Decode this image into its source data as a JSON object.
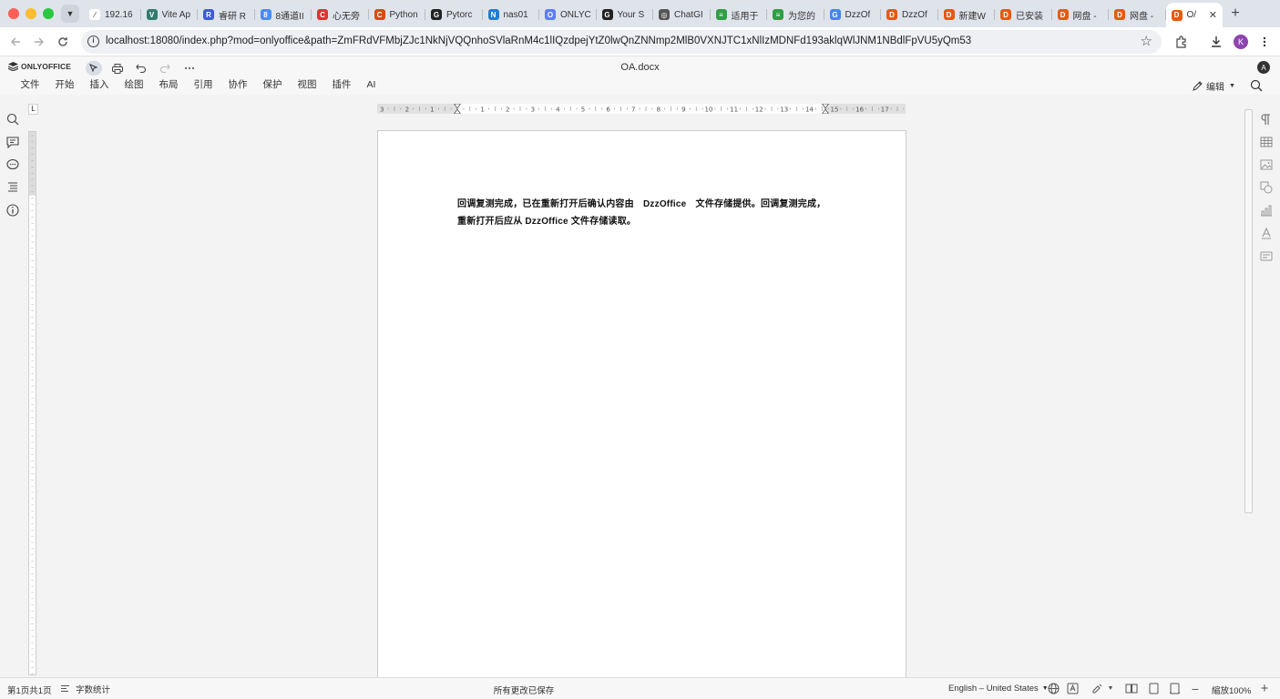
{
  "browser": {
    "tabs": [
      {
        "title": "192.16",
        "fav_color": "#ffffff",
        "fav_glyph": "⁄",
        "active": false
      },
      {
        "title": "Vite Ap",
        "fav_color": "#2e7d6b",
        "fav_glyph": "V",
        "active": false
      },
      {
        "title": "睿研 R",
        "fav_color": "#3b5bdb",
        "fav_glyph": "R",
        "active": false
      },
      {
        "title": "8通道II",
        "fav_color": "#4c8bf5",
        "fav_glyph": "8",
        "active": false
      },
      {
        "title": "心无旁",
        "fav_color": "#e03131",
        "fav_glyph": "C",
        "active": false
      },
      {
        "title": "Python",
        "fav_color": "#d9480f",
        "fav_glyph": "C",
        "active": false
      },
      {
        "title": "Pytorc",
        "fav_color": "#222222",
        "fav_glyph": "G",
        "active": false
      },
      {
        "title": "nas01",
        "fav_color": "#1c7ed6",
        "fav_glyph": "N",
        "active": false
      },
      {
        "title": "ONLYC",
        "fav_color": "#5c7cfa",
        "fav_glyph": "O",
        "active": false
      },
      {
        "title": "Your S",
        "fav_color": "#222222",
        "fav_glyph": "G",
        "active": false
      },
      {
        "title": "ChatGI",
        "fav_color": "#555555",
        "fav_glyph": "◎",
        "active": false
      },
      {
        "title": "适用于",
        "fav_color": "#2f9e44",
        "fav_glyph": "≡",
        "active": false
      },
      {
        "title": "为您的",
        "fav_color": "#2f9e44",
        "fav_glyph": "≡",
        "active": false
      },
      {
        "title": "DzzOf",
        "fav_color": "#4285f4",
        "fav_glyph": "G",
        "active": false
      },
      {
        "title": "DzzOf",
        "fav_color": "#e8590c",
        "fav_glyph": "D",
        "active": false
      },
      {
        "title": "新建W",
        "fav_color": "#e8590c",
        "fav_glyph": "D",
        "active": false
      },
      {
        "title": "已安装",
        "fav_color": "#e8590c",
        "fav_glyph": "D",
        "active": false
      },
      {
        "title": "网盘 -",
        "fav_color": "#e8590c",
        "fav_glyph": "D",
        "active": false
      },
      {
        "title": "网盘 -",
        "fav_color": "#e8590c",
        "fav_glyph": "D",
        "active": false
      },
      {
        "title": "O/",
        "fav_color": "#e8590c",
        "fav_glyph": "D",
        "active": true
      }
    ],
    "tab_close_glyph": "✕",
    "new_tab_glyph": "+",
    "url": "localhost:18080/index.php?mod=onlyoffice&path=ZmFRdVFMbjZJc1NkNjVQQnhoSVlaRnM4c1lIQzdpejYtZ0lwQnZNNmp2MlB0VXNJTC1xNlIzMDNFd193aklqWlJNM1NBdlFpVU5yQm53",
    "avatar_letter": "K",
    "colors": {
      "tabbar": "#dfe3ea",
      "close": "#ff5f57",
      "minimize": "#febc2e",
      "zoom": "#28c840"
    }
  },
  "editor": {
    "logo_text": "ONLYOFFICE",
    "doc_title": "OA.docx",
    "user_initial": "A",
    "menu": [
      "文件",
      "开始",
      "插入",
      "绘图",
      "布局",
      "引用",
      "协作",
      "保护",
      "视图",
      "插件",
      "AI"
    ],
    "edit_mode_label": "编辑",
    "ruler_corner": "L",
    "document_text": "回调复测完成，已在重新打开后确认内容由　DzzOffice　文件存储提供。回调复测完成，重新打开后应从 DzzOffice 文件存储读取。"
  },
  "statusbar": {
    "page_info": "第1页共1页",
    "word_count": "字数统计",
    "saved": "所有更改已保存",
    "language": "English – United States",
    "zoom": "縮放100%"
  }
}
